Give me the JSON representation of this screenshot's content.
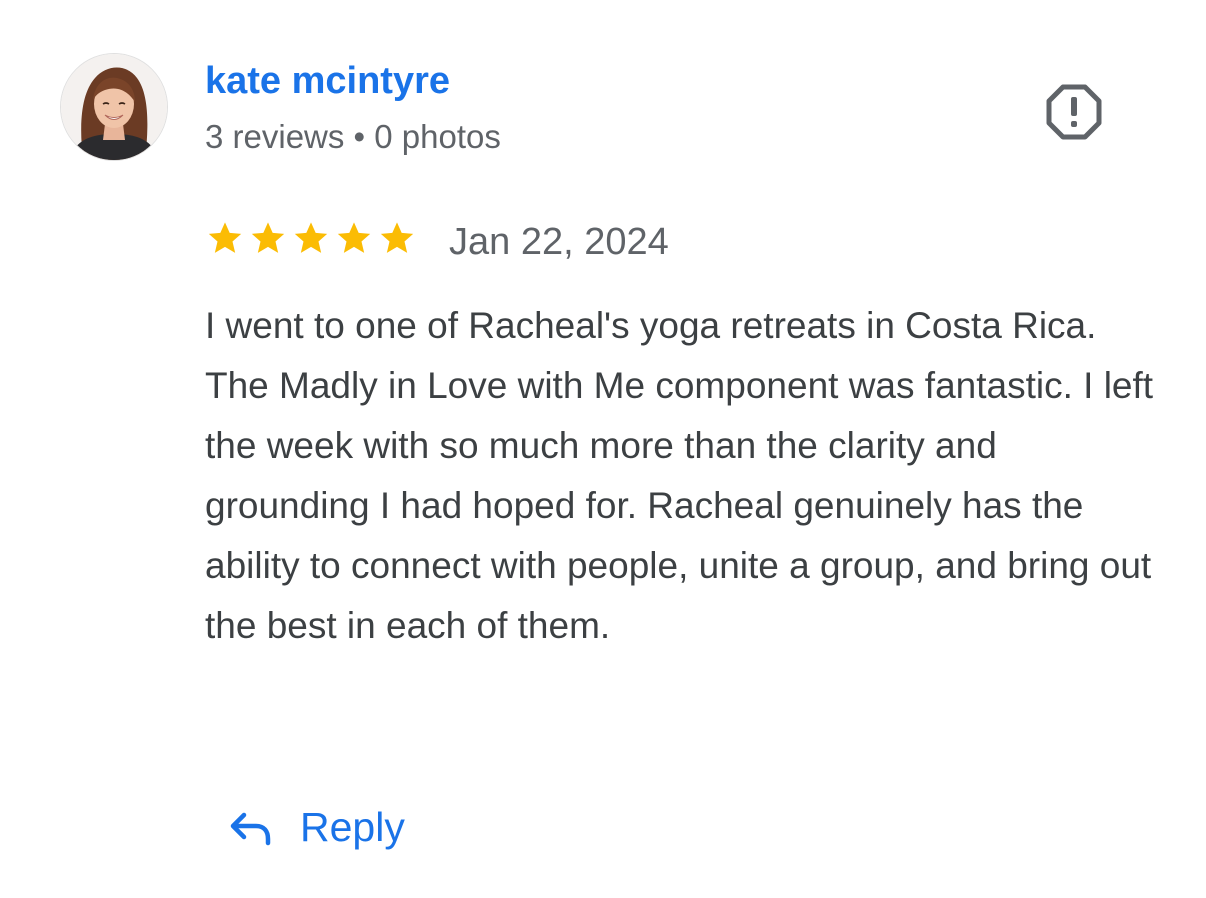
{
  "reviewer": {
    "name": "kate mcintyre",
    "meta": "3 reviews • 0 photos",
    "avatar_icon": "profile-photo"
  },
  "review": {
    "rating": 5,
    "rating_max": 5,
    "date": "Jan 22, 2024",
    "text": "I went to one of Racheal's yoga retreats in Costa Rica. The Madly in Love with Me component was fantastic. I left the week with so much more than the clarity and grounding I had hoped for. Racheal genuinely has the ability to connect with people, unite a group, and bring out the best in each of them."
  },
  "actions": {
    "reply_label": "Reply",
    "reply_icon": "reply-arrow-icon",
    "report_icon": "report-octagon-icon"
  },
  "colors": {
    "link_blue": "#1a73e8",
    "star_yellow": "#fbbc04",
    "meta_gray": "#5f6368",
    "text_dark": "#3c4043"
  }
}
